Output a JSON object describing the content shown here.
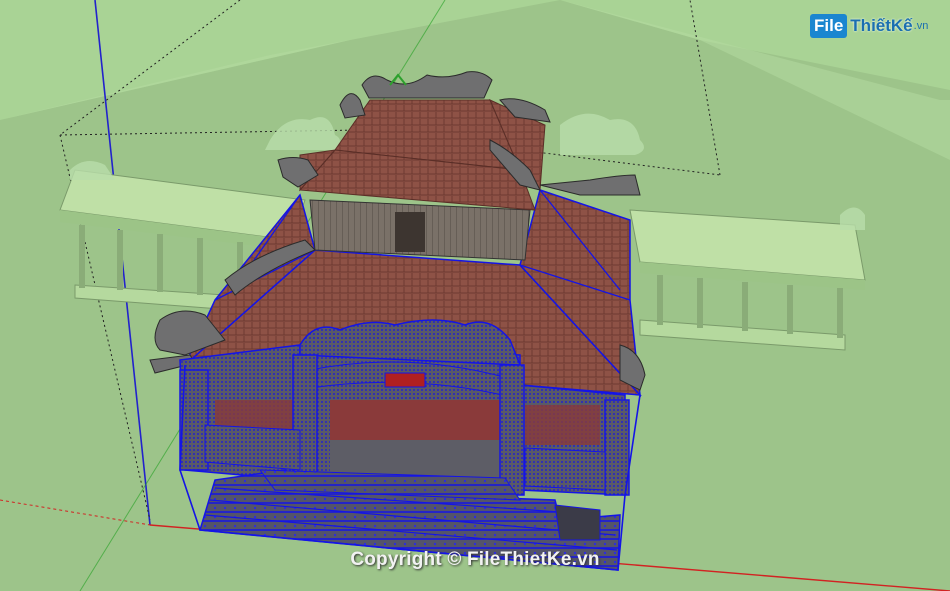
{
  "logo": {
    "box": "File",
    "name": "ThiếtKế",
    "suffix": ".vn"
  },
  "watermark": {
    "text": "Copyright © FileThietKe.vn"
  },
  "colors": {
    "ground": "#9dc48a",
    "sky_plane": "#a9d395",
    "roof": "#8e5246",
    "selection": "#1414e6",
    "stone": "#6f6f70",
    "axis_red": "#d22222",
    "axis_green": "#22a022",
    "axis_blue": "#2222cc"
  }
}
